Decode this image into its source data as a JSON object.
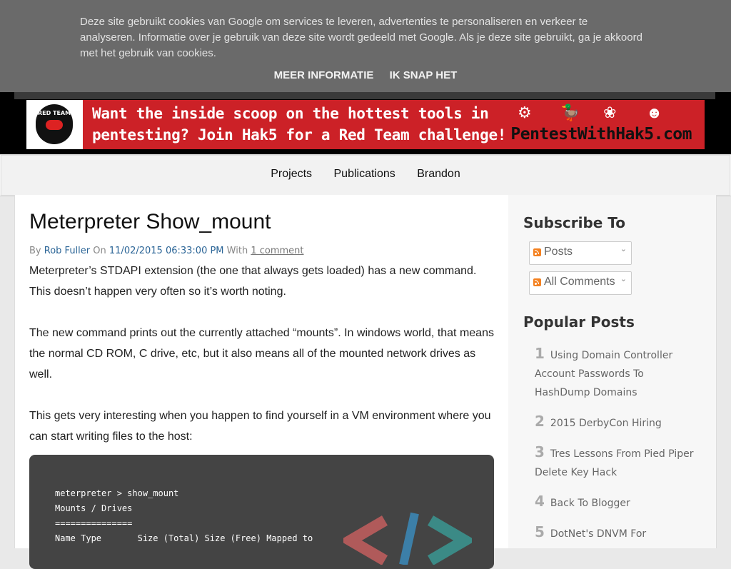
{
  "cookie": {
    "text": "Deze site gebruikt cookies van Google om services te leveren, advertenties te personaliseren en verkeer te analyseren. Informatie over je gebruik van deze site wordt gedeeld met Google. Als je deze site gebruikt, ga je akkoord met het gebruik van cookies.",
    "more_info": "MEER INFORMATIE",
    "accept": "IK SNAP HET"
  },
  "banner": {
    "logo_text": "RED TEAM",
    "headline_1": "Want the inside scoop on the hottest tools in",
    "headline_2": "pentesting? Join Hak5 for a Red Team challenge!",
    "site": "PentestWithHak5.com"
  },
  "nav": {
    "items": [
      "Projects",
      "Publications",
      "Brandon"
    ]
  },
  "post": {
    "title": "Meterpreter Show_mount",
    "by": "By",
    "author": "Rob Fuller",
    "on": "On",
    "date": "11/02/2015 06:33:00 PM",
    "with": "With",
    "comments": "1 comment",
    "paragraphs": [
      "Meterpreter’s STDAPI extension (the one that always gets loaded) has a new command. This doesn’t happen very often so it’s worth noting.",
      "The new command prints out the currently attached “mounts”. In windows world, that means the normal CD ROM, C drive, etc, but it also means all of the mounted network drives as well.",
      "This gets very interesting when you happen to find yourself in a VM environment where you can start writing files to the host:"
    ],
    "code": "meterpreter > show_mount\nMounts / Drives\n===============\nName Type       Size (Total) Size (Free) Mapped to"
  },
  "sidebar": {
    "subscribe_heading": "Subscribe To",
    "subscribe_posts": "Posts",
    "subscribe_comments": "All Comments",
    "popular_heading": "Popular Posts",
    "popular": [
      {
        "num": "1",
        "title": "Using Domain Controller Account Passwords To HashDump Domains"
      },
      {
        "num": "2",
        "title": "2015 DerbyCon Hiring"
      },
      {
        "num": "3",
        "title": "Tres Lessons From Pied Piper Delete Key Hack"
      },
      {
        "num": "4",
        "title": "Back To Blogger"
      },
      {
        "num": "5",
        "title": "DotNet's DNVM For"
      }
    ]
  },
  "colors": {
    "cookie_bg": "#6a6a6a",
    "banner_red": "#cc2127",
    "link_blue": "#2a6496",
    "code_bg": "#444444"
  }
}
